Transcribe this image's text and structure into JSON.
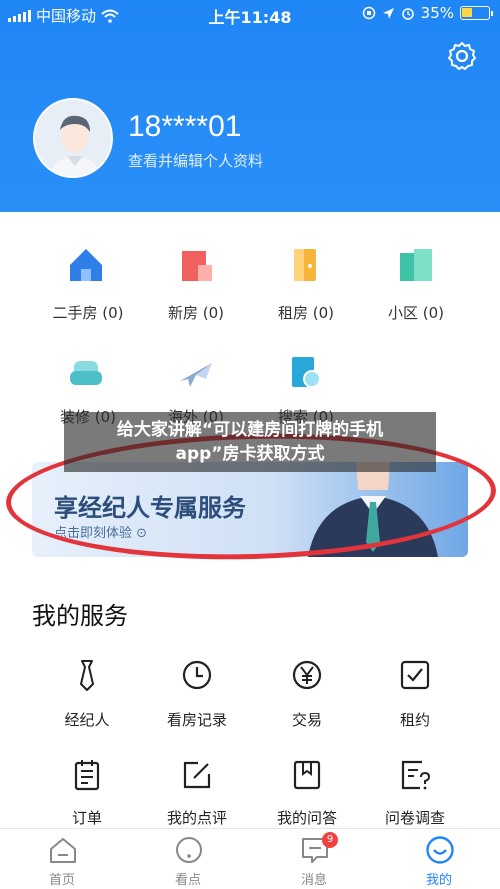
{
  "status_bar": {
    "carrier": "中国移动",
    "time": "上午11:48",
    "battery": "35%",
    "battery_level_percent": 35
  },
  "profile": {
    "phone": "18****01",
    "subtitle": "查看并编辑个人资料"
  },
  "categories": [
    {
      "label": "二手房 (0)",
      "icon": "house-icon",
      "color": "#2f7fe9"
    },
    {
      "label": "新房 (0)",
      "icon": "building-icon",
      "color": "#f0605f"
    },
    {
      "label": "租房 (0)",
      "icon": "door-icon",
      "color": "#f6b53a"
    },
    {
      "label": "小区 (0)",
      "icon": "community-icon",
      "color": "#3ec3a6"
    },
    {
      "label": "装修 (0)",
      "icon": "sofa-icon",
      "color": "#4cc0c8"
    },
    {
      "label": "海外 (0)",
      "icon": "plane-icon",
      "color": "#8aa9d6"
    },
    {
      "label": "搜索 (0)",
      "icon": "search-doc-icon",
      "color": "#29a8d9"
    }
  ],
  "overlay_caption": {
    "line1": "给大家讲解“可以建房间打牌的手机",
    "line2": "app”房卡获取方式"
  },
  "banner": {
    "title": "享经纪人专属服务",
    "subtitle": "点击即刻体验 ⊙"
  },
  "services": {
    "title": "我的服务",
    "items": [
      {
        "label": "经纪人",
        "icon": "tie-icon"
      },
      {
        "label": "看房记录",
        "icon": "clock-icon"
      },
      {
        "label": "交易",
        "icon": "yen-icon"
      },
      {
        "label": "租约",
        "icon": "checkbox-icon"
      },
      {
        "label": "订单",
        "icon": "order-icon"
      },
      {
        "label": "我的点评",
        "icon": "edit-icon"
      },
      {
        "label": "我的问答",
        "icon": "bookmark-icon"
      },
      {
        "label": "问卷调查",
        "icon": "survey-icon"
      }
    ]
  },
  "tabs": [
    {
      "label": "首页",
      "icon": "home-icon"
    },
    {
      "label": "看点",
      "icon": "discover-icon"
    },
    {
      "label": "消息",
      "icon": "message-icon",
      "badge": "9"
    },
    {
      "label": "我的",
      "icon": "profile-icon",
      "active": true
    }
  ],
  "colors": {
    "brand_blue": "#1f86f6",
    "highlight_red": "#e2343a"
  }
}
